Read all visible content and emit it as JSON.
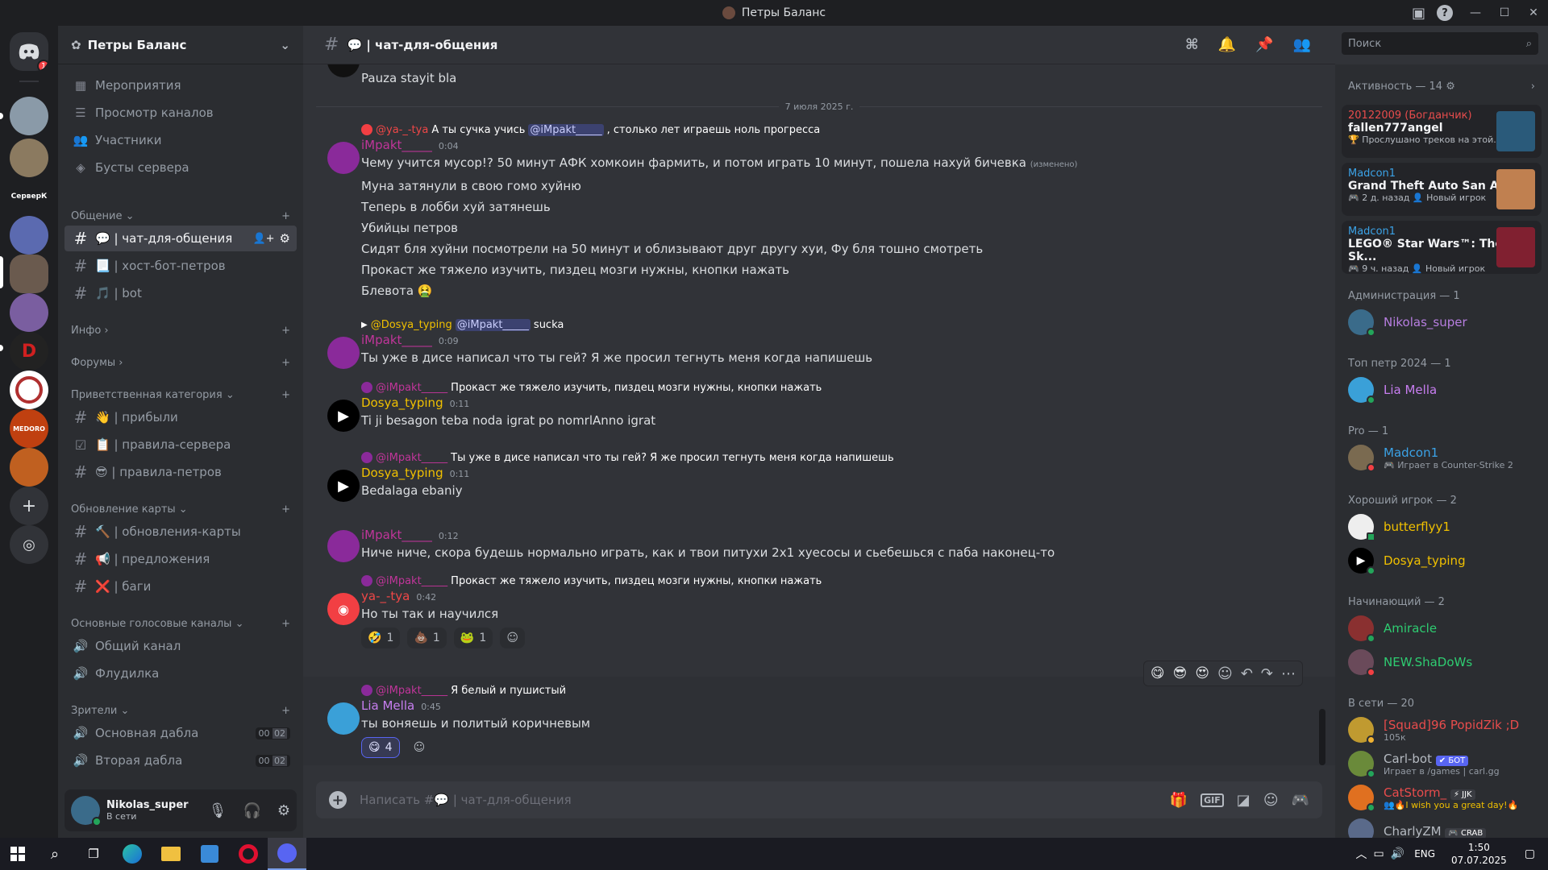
{
  "window": {
    "title": "Петры Баланс"
  },
  "servers": [
    {
      "label": "",
      "color": "#5865f2"
    },
    {
      "label": "",
      "color": "#8a9aa8"
    },
    {
      "label": "",
      "color": "#8b7a60"
    },
    {
      "label": "СерверК",
      "color": "#1e1f22"
    },
    {
      "label": "",
      "color": "#5b6ab0"
    },
    {
      "label": "",
      "color": "#6a5a4e"
    },
    {
      "label": "",
      "color": "#7a5ea0"
    },
    {
      "label": "D",
      "color": "#222"
    },
    {
      "label": "",
      "color": "#b03030"
    },
    {
      "label": "MEDORO",
      "color": "#c04010"
    },
    {
      "label": "",
      "color": "#c06020"
    }
  ],
  "server_badge": "1",
  "guild": {
    "name": "Петры Баланс"
  },
  "top_links": [
    {
      "icon": "calendar-icon",
      "label": "Мероприятия"
    },
    {
      "icon": "list-icon",
      "label": "Просмотр каналов"
    },
    {
      "icon": "members-icon",
      "label": "Участники"
    },
    {
      "icon": "boost-icon",
      "label": "Бусты сервера"
    }
  ],
  "categories": {
    "c1": "Общение",
    "c2": "Инфо",
    "c3": "Форумы",
    "c4": "Приветственная категория",
    "c5": "Обновление карты",
    "c6": "Основные голосовые каналы",
    "c7": "Зрители"
  },
  "channels": {
    "chat": "💬 | чат-для-общения",
    "host": "📃 | хост-бот-петров",
    "bot": "🎵 | bot",
    "arrived": "👋 | прибыли",
    "rules_server": "📋 | правила-сервера",
    "rules_petr": "😎 | правила-петров",
    "updates": "🔨 | обновления-карты",
    "offers": "📢 | предложения",
    "bugs": "❌ | баги",
    "voice1": "Общий канал",
    "voice2": "Флудилка",
    "voice3": "Основная дабла",
    "voice4": "Вторая дабла",
    "v3a": "00",
    "v3b": "02",
    "v4a": "00",
    "v4b": "02"
  },
  "user": {
    "name": "Nikolas_super",
    "status": "В сети"
  },
  "chat": {
    "channel": "💬 | чат-для-общения",
    "date_divider": "7 июля 2025 г.",
    "placeholder": "Написать #💬 | чат-для-общения"
  },
  "messages": {
    "m0": {
      "text": "Pauza stayit bla"
    },
    "m1": {
      "reply_user": "@ya-_-tya",
      "reply_a": "А ты сучка учись",
      "reply_mention": "@iMpakt_____",
      "reply_b": ", столько лет играешь ноль прогресса",
      "user": "iMpakt_____",
      "time": "0:04",
      "lines": [
        "Чему учится мусор!? 50 минут АФК хомкоин фармить, и потом играть 10 минут, пошела нахуй бичевка",
        "Муна затянули в свою гомо хуйню",
        "Теперь в лобби хуй затянешь",
        "Убийцы петров",
        "Сидят бля хуйни посмотрели на 50 минут и облизывают друг другу хуи, Фу бля тошно смотреть",
        "Прокаст же тяжело изучить, пиздец мозги нужны, кнопки нажать",
        "Блевота 🤮"
      ],
      "edited": "(изменено)"
    },
    "m2": {
      "reply_user": "@Dosya_typing",
      "reply_mention": "@iMpakt_____",
      "reply_b": "sucka",
      "user": "iMpakt_____",
      "time": "0:09",
      "text": "Ты уже в дисе написал что ты гей? Я же просил тегнуть меня когда напишешь"
    },
    "m3": {
      "reply_user": "@iMpakt_____",
      "reply_text": "Прокаст же тяжело изучить, пиздец мозги нужны, кнопки нажать",
      "user": "Dosya_typing",
      "time": "0:11",
      "text": "Ti ji besagon teba noda igrat po nomrlAnno igrat"
    },
    "m4": {
      "reply_user": "@iMpakt_____",
      "reply_text": "Ты уже в дисе написал что ты гей? Я же просил тегнуть меня когда напишешь",
      "user": "Dosya_typing",
      "time": "0:11",
      "text": "Bedalaga ebaniy"
    },
    "m5": {
      "user": "iMpakt_____",
      "time": "0:12",
      "text": "Ниче ниче, скора будешь нормально играть, как и твои питухи 2х1 хуесосы и сьебешься с паба наконец-то"
    },
    "m6": {
      "reply_user": "@iMpakt_____",
      "reply_text": "Прокаст же тяжело изучить, пиздец мозги нужны, кнопки нажать",
      "user": "ya-_-tya",
      "time": "0:42",
      "text": "Но ты так и научился",
      "reactions": [
        {
          "emoji": "🤣",
          "count": "1"
        },
        {
          "emoji": "💩",
          "count": "1"
        },
        {
          "emoji": "🐸",
          "count": "1"
        }
      ]
    },
    "m7": {
      "reply_user": "@iMpakt_____",
      "reply_text": "Я белый и пушистый",
      "user": "Lia Mella",
      "time": "0:45",
      "text": "ты воняешь и политый коричневым",
      "reactions": [
        {
          "emoji": "😋",
          "count": "4"
        }
      ]
    }
  },
  "hover_toolbar": [
    "😋",
    "😎",
    "😍"
  ],
  "search": {
    "placeholder": "Поиск"
  },
  "activity": {
    "header": "Активность — 14",
    "cards": [
      {
        "user": "20122009 (Богданчик)",
        "title": "fallen777angel",
        "sub": "🏆 Прослушано треков на этой..."
      },
      {
        "user": "Madcon1",
        "title": "Grand Theft Auto San Andr...",
        "sub": "🎮 2 д. назад   👤 Новый игрок"
      },
      {
        "user": "Madcon1",
        "title": "LEGO® Star Wars™: The Sk...",
        "sub": "🎮 9 ч. назад   👤 Новый игрок"
      }
    ]
  },
  "member_groups": {
    "admin": "Администрация — 1",
    "top": "Топ петр 2024 — 1",
    "pro": "Pro — 1",
    "good": "Хороший игрок — 2",
    "beginner": "Начинающий — 2",
    "online": "В сети — 20"
  },
  "members": {
    "nikolas": {
      "name": "Nikolas_super",
      "color": "#b77ee0"
    },
    "lia": {
      "name": "Lia Mella",
      "color": "#c77ef0"
    },
    "madcon": {
      "name": "Madcon1",
      "sub": "🎮 Играет в Counter-Strike 2",
      "color": "#3ba2e6"
    },
    "butterfly": {
      "name": "butterflyy1",
      "color": "#f0c000"
    },
    "dosya": {
      "name": "Dosya_typing",
      "color": "#f0c000"
    },
    "amiracle": {
      "name": "Amiracle",
      "color": "#2ecc71"
    },
    "shadows": {
      "name": "NEW.ShaDoWs",
      "color": "#2ecc71"
    },
    "popid": {
      "name": "[Squad]96 PopidZik ;D",
      "sub": "105к",
      "color": "#e84c4c"
    },
    "carlbot": {
      "name": "Carl-bot",
      "badge": "✔ БОТ",
      "sub": "Играет в /games | carl.gg",
      "color": "#b5bac1"
    },
    "catstorm": {
      "name": "CatStorm_",
      "badge": "⚡ JJK",
      "sub": "👥🔥I wish you a great day!🔥",
      "color": "#e84c4c"
    },
    "charly": {
      "name": "CharlyZM",
      "badge": "🎮 CRAB",
      "color": "#b5bac1"
    }
  },
  "taskbar": {
    "lang": "ENG",
    "time": "1:50",
    "date": "07.07.2025"
  }
}
